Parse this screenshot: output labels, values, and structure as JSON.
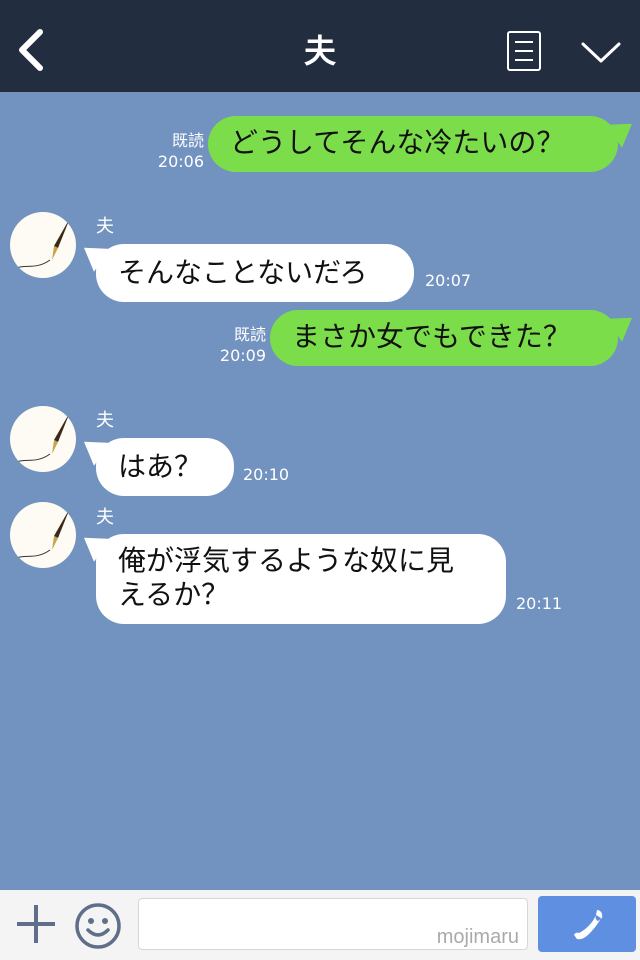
{
  "header": {
    "title": "夫",
    "back_icon": "chevron-left-icon",
    "menu_icon": "list-icon",
    "more_icon": "chevron-down-icon"
  },
  "colors": {
    "header_bg": "#232d40",
    "chat_bg": "#7292c0",
    "sent_bubble": "#7cdd4a",
    "received_bubble": "#ffffff",
    "call_button": "#5f8fe0"
  },
  "messages": [
    {
      "dir": "sent",
      "text": "どうしてそんな冷たいの？",
      "read": "既読",
      "time": "20:06"
    },
    {
      "dir": "received",
      "sender": "夫",
      "text": "そんなことないだろ",
      "time": "20:07"
    },
    {
      "dir": "sent",
      "text": "まさか女でもできた？",
      "read": "既読",
      "time": "20:09"
    },
    {
      "dir": "received",
      "sender": "夫",
      "text": "はあ？",
      "time": "20:10"
    },
    {
      "dir": "received",
      "sender": "夫",
      "text_lines": [
        "俺が浮気するような奴に見",
        "えるか？"
      ],
      "time": "20:11"
    }
  ],
  "footer": {
    "plus_icon": "plus-icon",
    "emoji_icon": "smile-icon",
    "input_value": "",
    "input_placeholder": "mojimaru",
    "call_icon": "phone-icon"
  }
}
